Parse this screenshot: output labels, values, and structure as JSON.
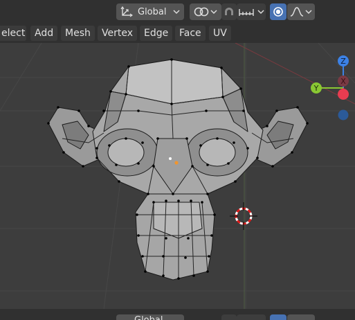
{
  "header": {
    "orientation_label": "Global",
    "proportional_active_color": "#4772b3"
  },
  "menubar": {
    "items": [
      "elect",
      "Add",
      "Mesh",
      "Vertex",
      "Edge",
      "Face",
      "UV"
    ]
  },
  "gizmo": {
    "z_label": "Z",
    "y_label": "Y",
    "x_label": "X",
    "colors": {
      "x": "#e83c50",
      "y": "#8ac833",
      "z": "#3c82e6"
    }
  },
  "bottom": {
    "orientation_label": "Global"
  }
}
